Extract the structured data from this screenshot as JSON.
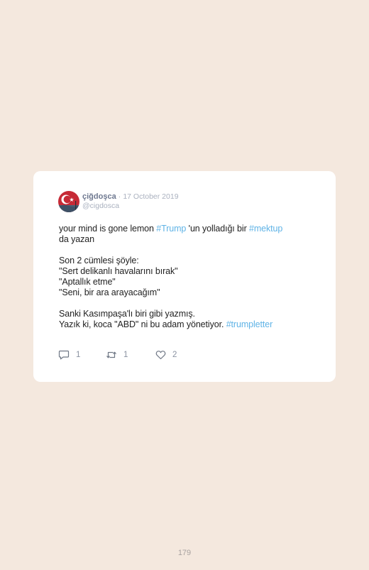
{
  "tweet": {
    "display_name": "çiğdoşca",
    "separator": "·",
    "date": "17 October 2019",
    "handle": "@cigdosca",
    "lines": [
      [
        {
          "text": "your mind is gone lemon ",
          "tag": false
        },
        {
          "text": "#Trump",
          "tag": true
        },
        {
          "text": " 'un yolladığı bir ",
          "tag": false
        },
        {
          "text": "#mektup",
          "tag": true
        }
      ],
      [
        {
          "text": "da yazan",
          "tag": false
        }
      ],
      null,
      [
        {
          "text": "Son 2 cümlesi şöyle:",
          "tag": false
        }
      ],
      [
        {
          "text": "\"Sert delikanlı havalarını bırak\"",
          "tag": false
        }
      ],
      [
        {
          "text": "\"Aptallık etme\"",
          "tag": false
        }
      ],
      [
        {
          "text": "\"Seni, bir ara arayacağım\"",
          "tag": false
        }
      ],
      null,
      [
        {
          "text": "Sanki Kasımpaşa'lı biri gibi yazmış.",
          "tag": false
        }
      ],
      [
        {
          "text": "Yazık ki, koca \"ABD\" ni bu adam yönetiyor. ",
          "tag": false
        },
        {
          "text": "#trumpletter",
          "tag": true
        }
      ]
    ],
    "actions": {
      "reply_count": "1",
      "retweet_count": "1",
      "like_count": "2"
    },
    "icons": {
      "reply": "reply-icon",
      "retweet": "retweet-icon",
      "like": "heart-icon",
      "avatar": "avatar-turkish-flag"
    }
  },
  "colors": {
    "page_background": "#f4e8de",
    "card_background": "#ffffff",
    "hashtag": "#5fb3e6",
    "name": "#6e7890",
    "muted": "#aab1bf",
    "text": "#222222"
  },
  "page": {
    "number": "179"
  }
}
